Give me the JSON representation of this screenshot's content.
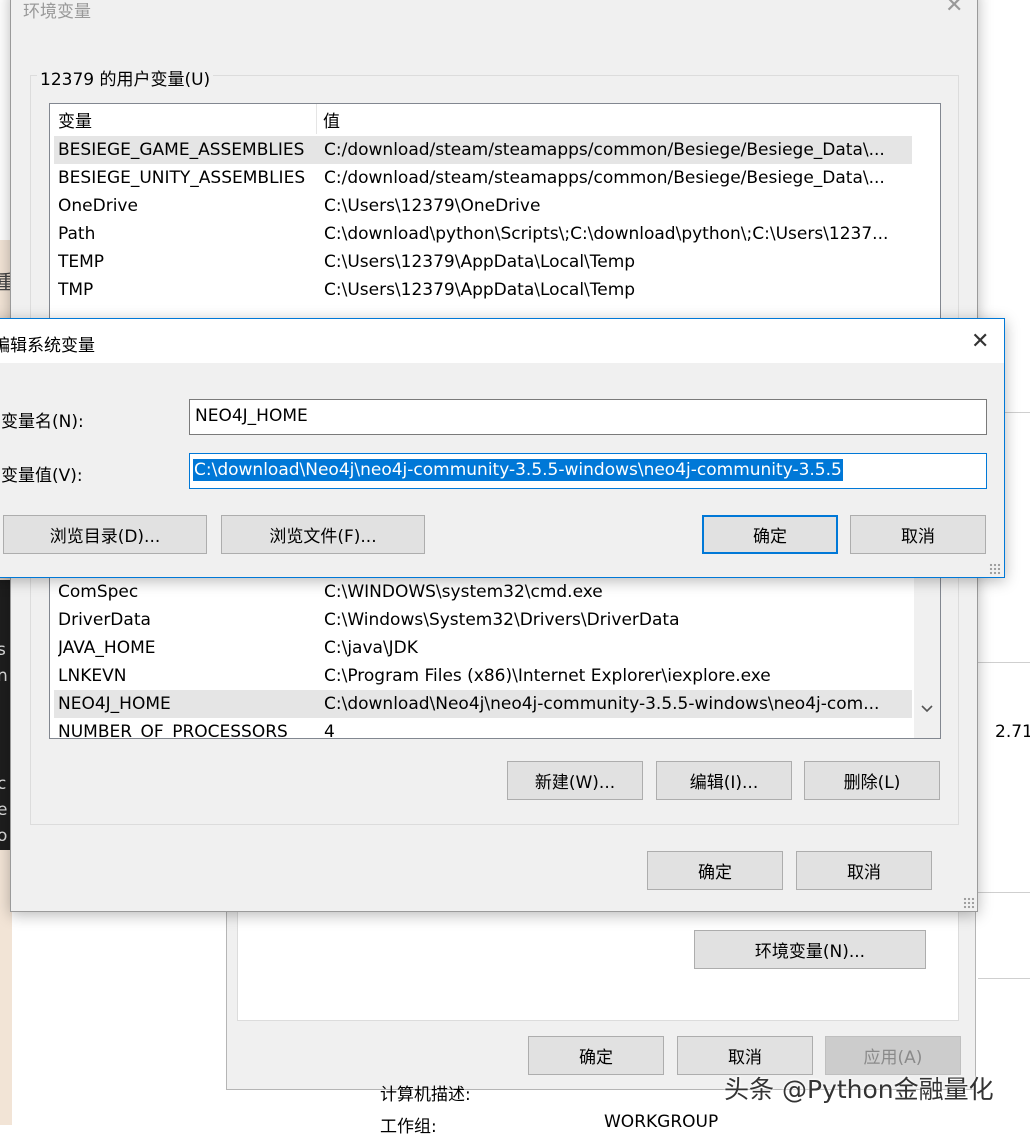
{
  "background": {
    "left_edge": [
      "重",
      "s",
      "n",
      "c",
      "e",
      "o"
    ],
    "right_value": "2.71",
    "footer_rows": [
      {
        "label": "计算机描述:",
        "value": ""
      },
      {
        "label": "工作组:",
        "value": "WORKGROUP"
      }
    ]
  },
  "system_properties": {
    "env_button": "环境变量(N)...",
    "ok": "确定",
    "cancel": "取消",
    "apply": "应用(A)"
  },
  "env_window": {
    "title": "环境变量",
    "user_group": "12379 的用户变量(U)",
    "header_name": "变量",
    "header_value": "值",
    "user_vars": [
      {
        "name": "BESIEGE_GAME_ASSEMBLIES",
        "value": "C:/download/steam/steamapps/common/Besiege/Besiege_Data\\..."
      },
      {
        "name": "BESIEGE_UNITY_ASSEMBLIES",
        "value": "C:/download/steam/steamapps/common/Besiege/Besiege_Data\\..."
      },
      {
        "name": "OneDrive",
        "value": "C:\\Users\\12379\\OneDrive"
      },
      {
        "name": "Path",
        "value": "C:\\download\\python\\Scripts\\;C:\\download\\python\\;C:\\Users\\1237..."
      },
      {
        "name": "TEMP",
        "value": "C:\\Users\\12379\\AppData\\Local\\Temp"
      },
      {
        "name": "TMP",
        "value": "C:\\Users\\12379\\AppData\\Local\\Temp"
      }
    ],
    "system_vars": [
      {
        "name": "ComSpec",
        "value": "C:\\WINDOWS\\system32\\cmd.exe"
      },
      {
        "name": "DriverData",
        "value": "C:\\Windows\\System32\\Drivers\\DriverData"
      },
      {
        "name": "JAVA_HOME",
        "value": "C:\\java\\JDK"
      },
      {
        "name": "LNKEVN",
        "value": "C:\\Program Files (x86)\\Internet Explorer\\iexplore.exe"
      },
      {
        "name": "NEO4J_HOME",
        "value": "C:\\download\\Neo4j\\neo4j-community-3.5.5-windows\\neo4j-com..."
      },
      {
        "name": "NUMBER_OF_PROCESSORS",
        "value": "4"
      }
    ],
    "new_button": "新建(W)...",
    "edit_button": "编辑(I)...",
    "delete_button": "删除(L)",
    "ok": "确定",
    "cancel": "取消"
  },
  "edit_dialog": {
    "title": "编辑系统变量",
    "name_label": "变量名(N):",
    "name_value": "NEO4J_HOME",
    "value_label": "变量值(V):",
    "value_value": "C:\\download\\Neo4j\\neo4j-community-3.5.5-windows\\neo4j-community-3.5.5",
    "browse_dir": "浏览目录(D)...",
    "browse_file": "浏览文件(F)...",
    "ok": "确定",
    "cancel": "取消"
  },
  "watermark": "头条 @Python金融量化",
  "colors": {
    "selection": "#0078d7",
    "selected_row": "#e5e5e5",
    "dialog_bg": "#f0f0f0",
    "primary_border": "#0078d7"
  }
}
